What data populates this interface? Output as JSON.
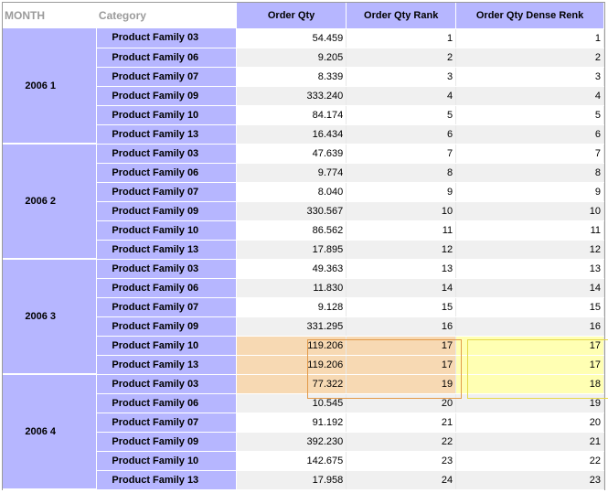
{
  "headers": {
    "month": "MONTH",
    "category": "Category",
    "order_qty": "Order Qty",
    "order_qty_rank": "Order Qty Rank",
    "order_qty_dense_rank": "Order Qty Dense Renk"
  },
  "groups": [
    {
      "month": "2006  1",
      "rows": [
        {
          "category": "Product Family 03",
          "qty": "54.459",
          "rank": "1",
          "dense": "1"
        },
        {
          "category": "Product Family 06",
          "qty": "9.205",
          "rank": "2",
          "dense": "2"
        },
        {
          "category": "Product Family 07",
          "qty": "8.339",
          "rank": "3",
          "dense": "3"
        },
        {
          "category": "Product Family 09",
          "qty": "333.240",
          "rank": "4",
          "dense": "4"
        },
        {
          "category": "Product Family 10",
          "qty": "84.174",
          "rank": "5",
          "dense": "5"
        },
        {
          "category": "Product Family 13",
          "qty": "16.434",
          "rank": "6",
          "dense": "6"
        }
      ]
    },
    {
      "month": "2006  2",
      "rows": [
        {
          "category": "Product Family 03",
          "qty": "47.639",
          "rank": "7",
          "dense": "7"
        },
        {
          "category": "Product Family 06",
          "qty": "9.774",
          "rank": "8",
          "dense": "8"
        },
        {
          "category": "Product Family 07",
          "qty": "8.040",
          "rank": "9",
          "dense": "9"
        },
        {
          "category": "Product Family 09",
          "qty": "330.567",
          "rank": "10",
          "dense": "10"
        },
        {
          "category": "Product Family 10",
          "qty": "86.562",
          "rank": "11",
          "dense": "11"
        },
        {
          "category": "Product Family 13",
          "qty": "17.895",
          "rank": "12",
          "dense": "12"
        }
      ]
    },
    {
      "month": "2006  3",
      "rows": [
        {
          "category": "Product Family 03",
          "qty": "49.363",
          "rank": "13",
          "dense": "13"
        },
        {
          "category": "Product Family 06",
          "qty": "11.830",
          "rank": "14",
          "dense": "14"
        },
        {
          "category": "Product Family 07",
          "qty": "9.128",
          "rank": "15",
          "dense": "15"
        },
        {
          "category": "Product Family 09",
          "qty": "331.295",
          "rank": "16",
          "dense": "16"
        },
        {
          "category": "Product Family 10",
          "qty": "119.206",
          "rank": "17",
          "dense": "17",
          "highlight": true
        },
        {
          "category": "Product Family 13",
          "qty": "119.206",
          "rank": "17",
          "dense": "17",
          "highlight": true
        }
      ]
    },
    {
      "month": "2006  4",
      "rows": [
        {
          "category": "Product Family 03",
          "qty": "77.322",
          "rank": "19",
          "dense": "18",
          "highlight": true
        },
        {
          "category": "Product Family 06",
          "qty": "10.545",
          "rank": "20",
          "dense": "19"
        },
        {
          "category": "Product Family 07",
          "qty": "91.192",
          "rank": "21",
          "dense": "20"
        },
        {
          "category": "Product Family 09",
          "qty": "392.230",
          "rank": "22",
          "dense": "21"
        },
        {
          "category": "Product Family 10",
          "qty": "142.675",
          "rank": "23",
          "dense": "22"
        },
        {
          "category": "Product Family 13",
          "qty": "17.958",
          "rank": "24",
          "dense": "23"
        }
      ]
    }
  ],
  "colors": {
    "header_fill": "#b6b6ff",
    "highlight_orange": "#f7d9b3",
    "highlight_yellow": "#ffffb3"
  }
}
